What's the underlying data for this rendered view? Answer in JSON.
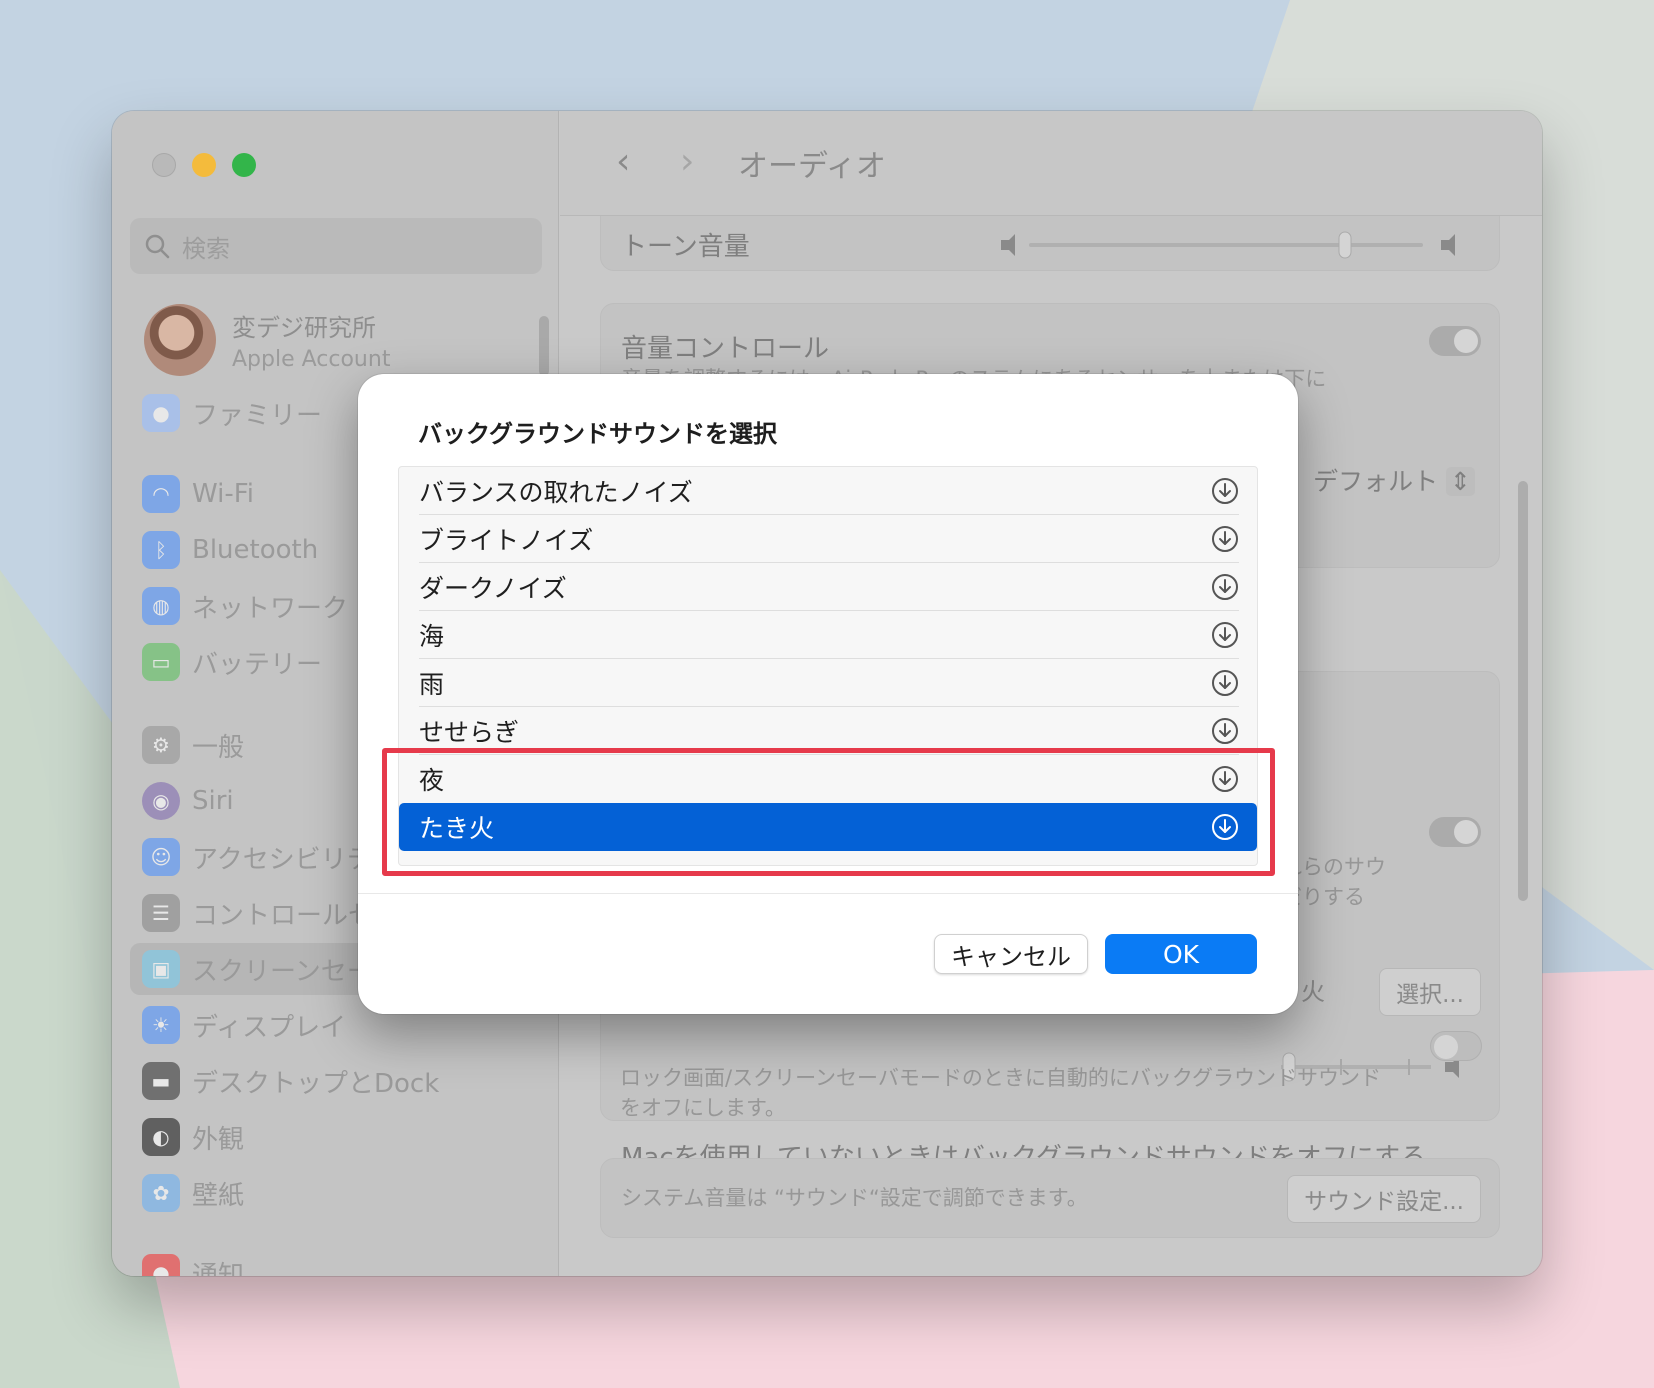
{
  "window": {
    "page_title": "オーディオ",
    "search_placeholder": "検索"
  },
  "account": {
    "name": "変デジ研究所",
    "subtitle": "Apple Account"
  },
  "sidebar": {
    "items": [
      {
        "label": "ファミリー",
        "icon": "family-icon",
        "color": "#a9c0e8"
      },
      {
        "label": "Wi-Fi",
        "icon": "wifi-icon",
        "color": "#7ea6e6"
      },
      {
        "label": "Bluetooth",
        "icon": "bluetooth-icon",
        "color": "#7ea6e6"
      },
      {
        "label": "ネットワーク",
        "icon": "network-icon",
        "color": "#7ea6e6"
      },
      {
        "label": "バッテリー",
        "icon": "battery-icon",
        "color": "#86c287"
      },
      {
        "label": "一般",
        "icon": "gear-icon",
        "color": "#a8a8a8"
      },
      {
        "label": "Siri",
        "icon": "siri-icon",
        "color": "#9c8fb8"
      },
      {
        "label": "アクセシビリティ",
        "icon": "accessibility-icon",
        "color": "#7ea6e6"
      },
      {
        "label": "コントロールセンター",
        "icon": "control-center-icon",
        "color": "#a0a0a0"
      },
      {
        "label": "スクリーンセーバ",
        "icon": "screensaver-icon",
        "color": "#91c4d8"
      },
      {
        "label": "ディスプレイ",
        "icon": "display-icon",
        "color": "#7ea6e6"
      },
      {
        "label": "デスクトップとDock",
        "icon": "dock-icon",
        "color": "#707070"
      },
      {
        "label": "外観",
        "icon": "appearance-icon",
        "color": "#606060"
      },
      {
        "label": "壁紙",
        "icon": "wallpaper-icon",
        "color": "#8fb8e0"
      },
      {
        "label": "通知",
        "icon": "notification-icon",
        "color": "#e07070"
      }
    ]
  },
  "main": {
    "tone_volume_label": "トーン音量",
    "volume_control_title": "音量コントロール",
    "volume_control_desc": "音量を調整するには、AirPods Proのステムにあるセンサーを上または下に",
    "default_select": "デフォルト",
    "bg_desc_1": "れらのサウ",
    "bg_desc_2": "だりする",
    "current_sound": "き火",
    "select_button": "選択...",
    "mac_off_title": "Macを使用していないときはバックグラウンドサウンドをオフにする",
    "mac_off_desc_1": "ロック画面/スクリーンセーバモードのときに自動的にバックグラウンドサウンド",
    "mac_off_desc_2": "をオフにします。",
    "system_volume_note": "システム音量は “サウンド“設定で調節できます。",
    "sound_settings_button": "サウンド設定..."
  },
  "dialog": {
    "title": "バックグラウンドサウンドを選択",
    "options": [
      {
        "label": "バランスの取れたノイズ",
        "icon": "download-icon",
        "selected": false
      },
      {
        "label": "ブライトノイズ",
        "icon": "download-icon",
        "selected": false
      },
      {
        "label": "ダークノイズ",
        "icon": "download-icon",
        "selected": false
      },
      {
        "label": "海",
        "icon": "download-icon",
        "selected": false
      },
      {
        "label": "雨",
        "icon": "download-icon",
        "selected": false
      },
      {
        "label": "せせらぎ",
        "icon": "download-icon",
        "selected": false
      },
      {
        "label": "夜",
        "icon": "download-icon",
        "selected": false
      },
      {
        "label": "たき火",
        "icon": "download-icon",
        "selected": true
      }
    ],
    "cancel_label": "キャンセル",
    "ok_label": "OK",
    "accent_color": "#0461d6",
    "highlight_color": "#e63a4b"
  }
}
